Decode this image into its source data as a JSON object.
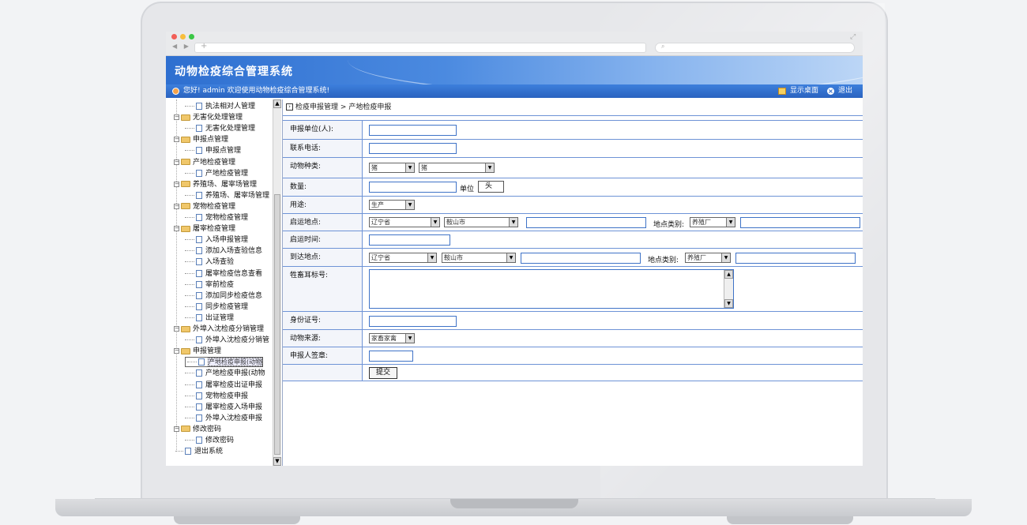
{
  "app": {
    "title": "动物检疫综合管理系统",
    "welcome": "您好! admin 欢迎使用动物检疫综合管理系统!",
    "show_desktop": "显示桌面",
    "exit": "退出"
  },
  "sidebar": {
    "items": [
      {
        "label": "执法相对人管理",
        "level": 2
      },
      {
        "label": "无害化处理管理",
        "level": 1
      },
      {
        "label": "无害化处理管理",
        "level": 2
      },
      {
        "label": "申报点管理",
        "level": 1
      },
      {
        "label": "申报点管理",
        "level": 2
      },
      {
        "label": "产地检疫管理",
        "level": 1
      },
      {
        "label": "产地检疫管理",
        "level": 2
      },
      {
        "label": "养殖场、屠宰场管理",
        "level": 1
      },
      {
        "label": "养殖场、屠宰场管理",
        "level": 2
      },
      {
        "label": "宠物检疫管理",
        "level": 1
      },
      {
        "label": "宠物检疫管理",
        "level": 2
      },
      {
        "label": "屠宰检疫管理",
        "level": 1
      },
      {
        "label": "入场申报管理",
        "level": 2
      },
      {
        "label": "添加入场查验信息",
        "level": 2
      },
      {
        "label": "入场查验",
        "level": 2
      },
      {
        "label": "屠宰检疫信息查看",
        "level": 2
      },
      {
        "label": "宰前检疫",
        "level": 2
      },
      {
        "label": "添加同步检疫信息",
        "level": 2
      },
      {
        "label": "同步检疫管理",
        "level": 2
      },
      {
        "label": "出证管理",
        "level": 2
      },
      {
        "label": "外埠入沈检疫分销管理",
        "level": 1
      },
      {
        "label": "外埠入沈检疫分销管",
        "level": 2
      },
      {
        "label": "申报管理",
        "level": 1
      },
      {
        "label": "产地检疫申报(动物",
        "level": 2
      },
      {
        "label": "产地检疫申报(动物",
        "level": 2
      },
      {
        "label": "屠宰检疫出证申报",
        "level": 2
      },
      {
        "label": "宠物检疫申报",
        "level": 2
      },
      {
        "label": "屠宰检疫入场申报",
        "level": 2
      },
      {
        "label": "外埠入沈检疫申报",
        "level": 2
      },
      {
        "label": "修改密码",
        "level": 1
      },
      {
        "label": "修改密码",
        "level": 2
      },
      {
        "label": "退出系统",
        "level": 0
      }
    ]
  },
  "breadcrumb": {
    "parent": "检疫申报管理",
    "separator": ">",
    "current": "产地检疫申报"
  },
  "form": {
    "applicant_label": "申报单位(人):",
    "phone_label": "联系电话:",
    "species_label": "动物种类:",
    "species_select1": "猪",
    "species_select2": "猪",
    "quantity_label": "数量:",
    "unit_label": "单位",
    "unit_value": "头",
    "usage_label": "用途:",
    "usage_value": "生产",
    "origin_label": "启运地点:",
    "origin_province": "辽宁省",
    "origin_city": "鞍山市",
    "origin_type_label": "地点类别:",
    "origin_type": "养殖厂",
    "start_time_label": "启运时间:",
    "dest_label": "到达地点:",
    "dest_province": "辽宁省",
    "dest_city": "鞍山市",
    "dest_type_label": "地点类别:",
    "dest_type": "养殖厂",
    "eartag_label": "牲畜耳标号:",
    "id_label": "身份证号:",
    "source_label": "动物来源:",
    "source_value": "家畜家禽",
    "sign_label": "申报人签章:",
    "submit": "提交"
  },
  "colors": {
    "header_blue": "#2e6fd0",
    "border_blue": "#6e93d6"
  }
}
